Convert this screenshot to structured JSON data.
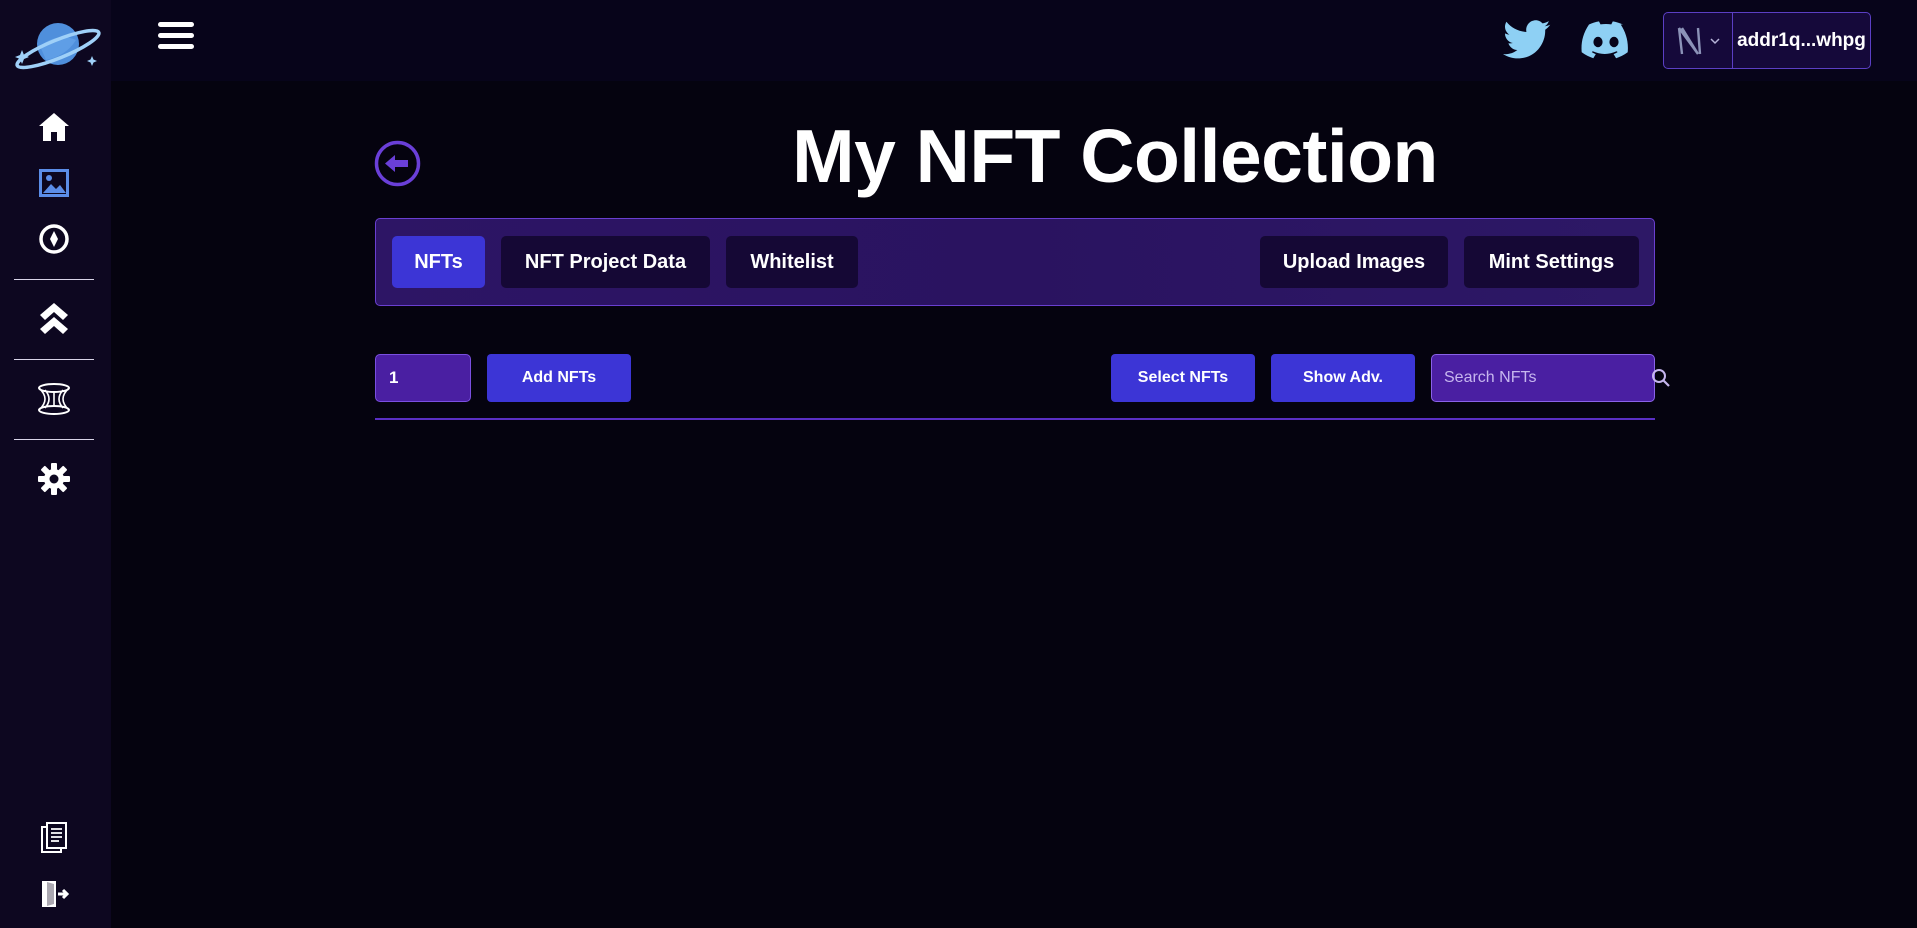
{
  "header": {
    "wallet_address": "addr1q...whpg"
  },
  "page": {
    "title": "My NFT Collection"
  },
  "tabs": {
    "left": [
      "NFTs",
      "NFT Project Data",
      "Whitelist"
    ],
    "right": [
      "Upload Images",
      "Mint Settings"
    ],
    "active": "NFTs"
  },
  "toolbar": {
    "quantity_value": "1",
    "add_label": "Add NFTs",
    "select_label": "Select NFTs",
    "advanced_label": "Show Adv.",
    "search_placeholder": "Search NFTs"
  },
  "sidebar": {
    "icons": [
      "home-icon",
      "image-icon",
      "compass-icon",
      "double-chevron-up-icon",
      "wormhole-icon",
      "gear-icon",
      "documents-icon",
      "logout-icon"
    ]
  },
  "colors": {
    "background": "#05030f",
    "sidebar": "#0d0720",
    "accent": "#3c35d6",
    "tab_bar": "#2d1565",
    "twitter": "#8ed0f4",
    "discord": "#8ed0f4"
  }
}
